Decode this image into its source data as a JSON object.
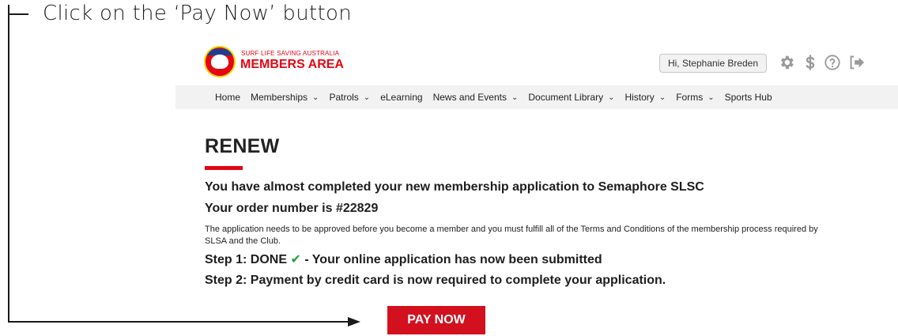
{
  "instruction": {
    "text": "Click on the ‘Pay Now’ button"
  },
  "header": {
    "logo_small": "SURF LIFE SAVING AUSTRALIA",
    "logo_big": "MEMBERS AREA",
    "greeting": "Hi, Stephanie Breden",
    "icons": [
      "gear-icon",
      "dollar-icon",
      "help-icon",
      "logout-icon"
    ]
  },
  "nav": {
    "items": [
      {
        "label": "Home",
        "dropdown": false
      },
      {
        "label": "Memberships",
        "dropdown": true
      },
      {
        "label": "Patrols",
        "dropdown": true
      },
      {
        "label": "eLearning",
        "dropdown": false
      },
      {
        "label": "News and Events",
        "dropdown": true
      },
      {
        "label": "Document Library",
        "dropdown": true
      },
      {
        "label": "History",
        "dropdown": true
      },
      {
        "label": "Forms",
        "dropdown": true
      },
      {
        "label": "Sports Hub",
        "dropdown": false
      }
    ],
    "chevron": "⌄"
  },
  "content": {
    "title": "RENEW",
    "line1": "You have almost completed your new membership application to Semaphore SLSC",
    "line2": "Your order number is #22829",
    "paragraph": "The application needs to be approved before you become a member and you must fulfill all of the Terms and Conditions of the membership process required by SLSA and the Club.",
    "step1_prefix": "Step 1: DONE",
    "step1_check": "✔",
    "step1_suffix": " - Your online application has now been submitted",
    "step2": "Step 2: Payment by credit card is now required to complete your application.",
    "pay_button": "PAY NOW"
  },
  "colors": {
    "brand_red": "#e30613",
    "button_red": "#d3101e",
    "check_green": "#1fa33a",
    "nav_bg": "#f2f2f2"
  }
}
